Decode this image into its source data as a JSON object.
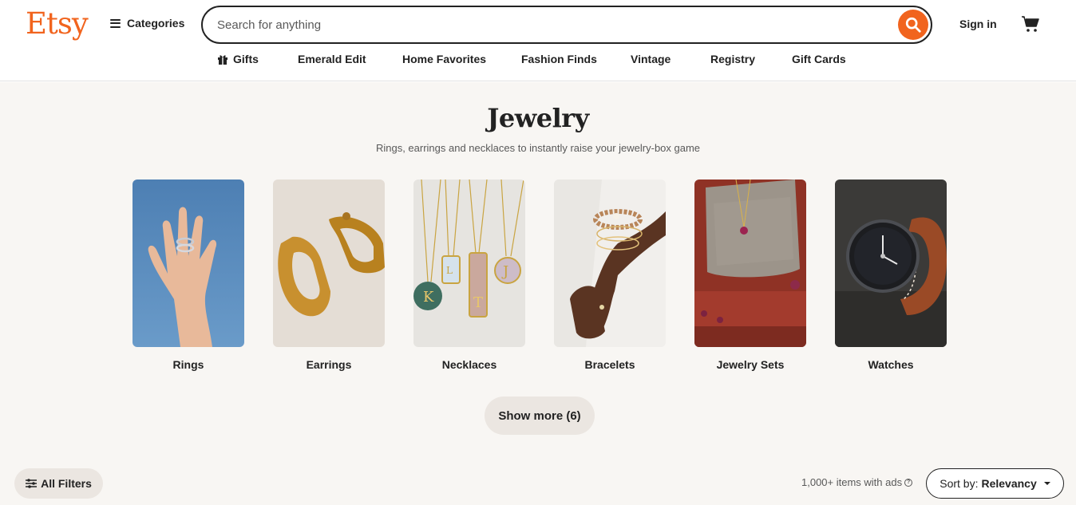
{
  "header": {
    "logo": "Etsy",
    "categories_label": "Categories",
    "search_placeholder": "Search for anything",
    "signin_label": "Sign in"
  },
  "nav": {
    "items": [
      "Gifts",
      "Emerald Edit",
      "Home Favorites",
      "Fashion Finds",
      "Vintage",
      "Registry",
      "Gift Cards"
    ]
  },
  "page": {
    "title": "Jewelry",
    "subtitle": "Rings, earrings and necklaces to instantly raise your jewelry-box game"
  },
  "categories": [
    {
      "label": "Rings"
    },
    {
      "label": "Earrings"
    },
    {
      "label": "Necklaces"
    },
    {
      "label": "Bracelets"
    },
    {
      "label": "Jewelry Sets"
    },
    {
      "label": "Watches"
    }
  ],
  "show_more_label": "Show more (6)",
  "filters": {
    "all_filters_label": "All Filters",
    "results_text": "1,000+ items with ads",
    "sort_prefix": "Sort by:",
    "sort_value": "Relevancy"
  },
  "colors": {
    "accent": "#f1641e",
    "page_background": "#f8f6f3"
  }
}
